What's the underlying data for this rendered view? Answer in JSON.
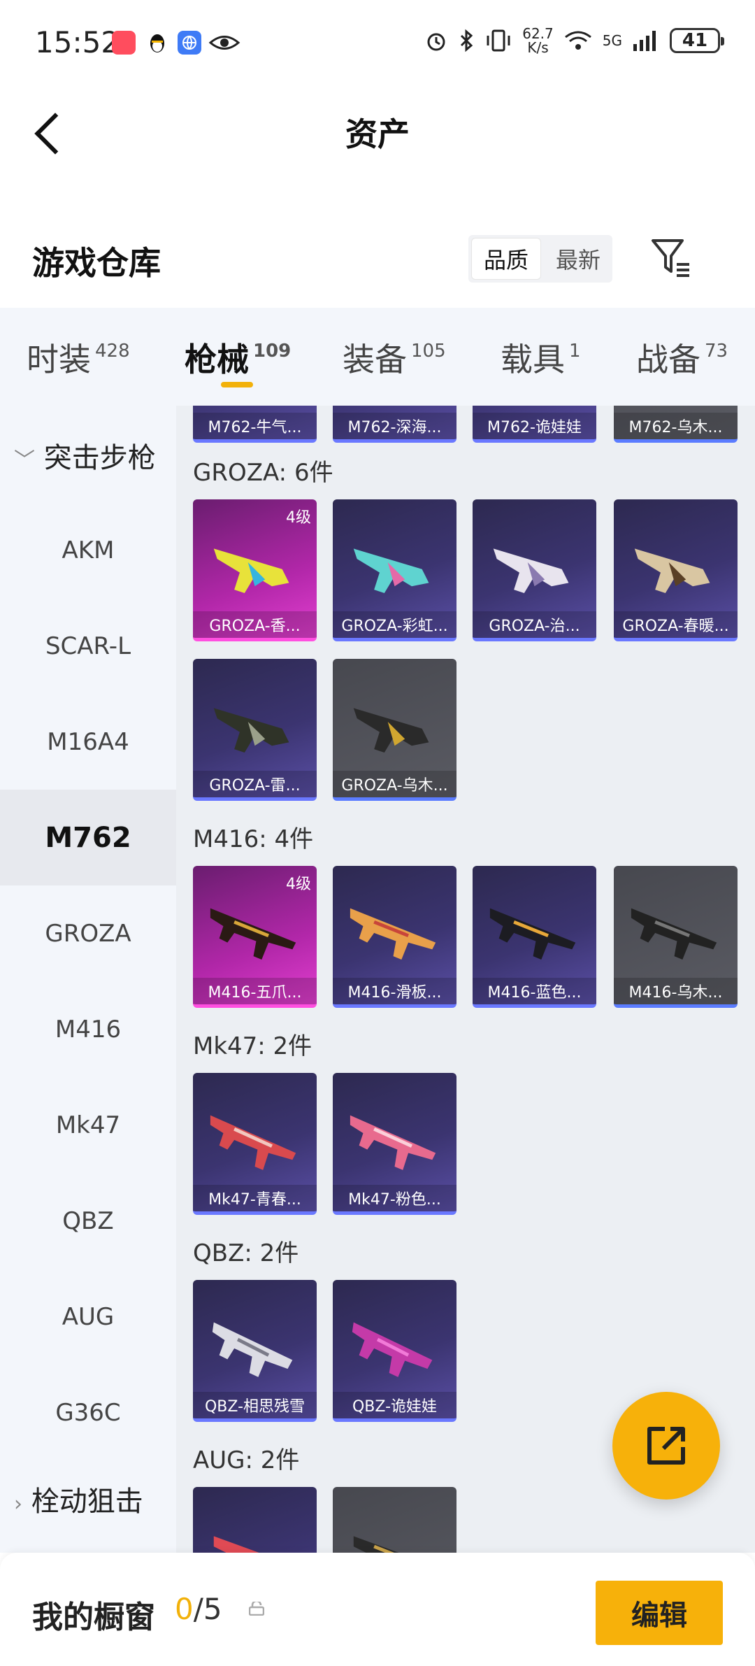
{
  "status": {
    "time": "15:52",
    "net_speed": "62.7\nK/s",
    "net_type": "5G",
    "battery": "41"
  },
  "header": {
    "title": "资产"
  },
  "warehouse": {
    "title": "游戏仓库",
    "sort_quality": "品质",
    "sort_newest": "最新"
  },
  "tabs": [
    {
      "label": "时装",
      "count": "428"
    },
    {
      "label": "枪械",
      "count": "109"
    },
    {
      "label": "装备",
      "count": "105"
    },
    {
      "label": "载具",
      "count": "1"
    },
    {
      "label": "战备",
      "count": "73"
    }
  ],
  "sidebar": {
    "category_assault": "突击步枪",
    "items": [
      "AKM",
      "SCAR-L",
      "M16A4",
      "M762",
      "GROZA",
      "M416",
      "Mk47",
      "QBZ",
      "AUG",
      "G36C"
    ],
    "category_bolt": "栓动狙击"
  },
  "groups": {
    "m762_top": [
      "M762-牛气...",
      "M762-深海...",
      "M762-诡娃娃",
      "M762-乌木..."
    ],
    "groza": {
      "title": "GROZA: 6件",
      "items": [
        "GROZA-香...",
        "GROZA-彩虹...",
        "GROZA-治...",
        "GROZA-春暖...",
        "GROZA-雷...",
        "GROZA-乌木..."
      ],
      "level": "4级"
    },
    "m416": {
      "title": "M416: 4件",
      "items": [
        "M416-五爪...",
        "M416-滑板...",
        "M416-蓝色...",
        "M416-乌木..."
      ],
      "level": "4级"
    },
    "mk47": {
      "title": "Mk47: 2件",
      "items": [
        "Mk47-青春...",
        "Mk47-粉色..."
      ]
    },
    "qbz": {
      "title": "QBZ: 2件",
      "items": [
        "QBZ-相思残雪",
        "QBZ-诡娃娃"
      ]
    },
    "aug": {
      "title": "AUG: 2件"
    }
  },
  "bottom": {
    "title": "我的橱窗",
    "count_used": "0",
    "count_total": "/5",
    "edit_label": "编辑"
  },
  "colors": {
    "accent": "#f7b10a",
    "tab_bg": "#f3f6fb",
    "content_bg": "#eceff3"
  }
}
